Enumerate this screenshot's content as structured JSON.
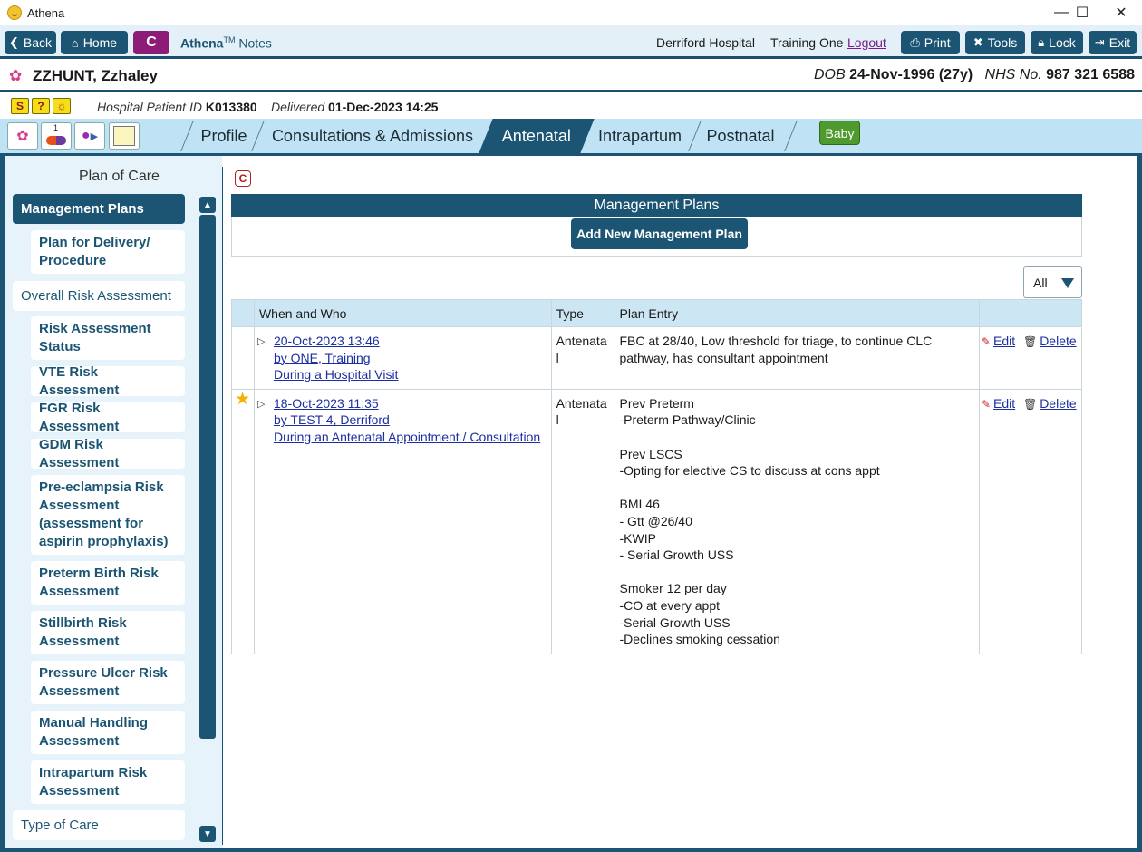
{
  "window": {
    "title": "Athena",
    "minimize": "—",
    "maximize": "☐",
    "close": "✕"
  },
  "toolbar": {
    "back": "Back",
    "home": "Home",
    "c_button": "C",
    "brand": "Athena",
    "brand_tm": "TM",
    "brand_suffix": "Notes",
    "hospital": "Derriford Hospital",
    "user": "Training One",
    "logout": "Logout",
    "print": "Print",
    "tools": "Tools",
    "lock": "Lock",
    "exit": "Exit"
  },
  "patient": {
    "name": "ZZHUNT, Zzhaley",
    "dob_label": "DOB",
    "dob": "24-Nov-1996 (27y)",
    "nhs_label": "NHS No.",
    "nhs": "987 321 6588"
  },
  "info": {
    "hospital_id_label": "Hospital Patient ID",
    "hospital_id": "K013380",
    "delivered_label": "Delivered",
    "delivered": "01-Dec-2023 14:25",
    "alert_icons": [
      "S",
      "?",
      "☼"
    ]
  },
  "tabs": {
    "items": [
      "Profile",
      "Consultations & Admissions",
      "Antenatal",
      "Intrapartum",
      "Postnatal"
    ],
    "active": "Antenatal",
    "baby": "Baby",
    "side_icons": [
      "flower-icon",
      "medication-icon",
      "person-next-icon",
      "notepad-icon"
    ],
    "med_badge": "1"
  },
  "sidebar": {
    "title": "Plan of Care",
    "items": [
      {
        "label": "Management Plans",
        "level": 0,
        "active": true
      },
      {
        "label": "Plan for Delivery/ Procedure",
        "level": 1
      },
      {
        "label": "Overall Risk Assessment",
        "level": 0
      },
      {
        "label": "Risk Assessment Status",
        "level": 1
      },
      {
        "label": "VTE Risk Assessment",
        "level": 1
      },
      {
        "label": "FGR Risk Assessment",
        "level": 1
      },
      {
        "label": "GDM Risk Assessment",
        "level": 1
      },
      {
        "label": "Pre-eclampsia Risk Assessment (assessment for aspirin prophylaxis)",
        "level": 1
      },
      {
        "label": "Preterm Birth Risk Assessment",
        "level": 1
      },
      {
        "label": "Stillbirth Risk Assessment",
        "level": 1
      },
      {
        "label": "Pressure Ulcer Risk Assessment",
        "level": 1
      },
      {
        "label": "Manual Handling Assessment",
        "level": 1
      },
      {
        "label": "Intrapartum Risk Assessment",
        "level": 1
      },
      {
        "label": "Type of Care",
        "level": 0
      }
    ]
  },
  "content": {
    "c_badge": "C",
    "header": "Management Plans",
    "add_button": "Add New Management Plan",
    "filter": "All",
    "columns": [
      "When and Who",
      "Type",
      "Plan Entry"
    ],
    "actions": {
      "edit": "Edit",
      "delete": "Delete"
    },
    "rows": [
      {
        "starred": false,
        "when": "20-Oct-2023 13:46",
        "who": "by ONE, Training",
        "context": "During a Hospital Visit",
        "type": "Antenatal",
        "plan": [
          "FBC at 28/40, Low threshold for triage, to continue CLC",
          "pathway, has consultant appointment"
        ]
      },
      {
        "starred": true,
        "when": "18-Oct-2023 11:35",
        "who": "by TEST 4, Derriford",
        "context": "During an Antenatal Appointment / Consultation",
        "type": "Antenatal",
        "plan": [
          "Prev Preterm",
          "-Preterm Pathway/Clinic",
          "",
          "Prev LSCS",
          "-Opting for elective CS to discuss at cons appt",
          "",
          "BMI 46",
          "- Gtt @26/40",
          "-KWIP",
          "- Serial Growth USS",
          "",
          "Smoker 12 per day",
          "-CO at every appt",
          "-Serial Growth USS",
          "-Declines smoking cessation"
        ]
      }
    ]
  },
  "colors": {
    "primary": "#1c5573",
    "accent": "#8c1c78",
    "baby": "#4f9a2e",
    "tabbar": "#bfe3f5"
  }
}
